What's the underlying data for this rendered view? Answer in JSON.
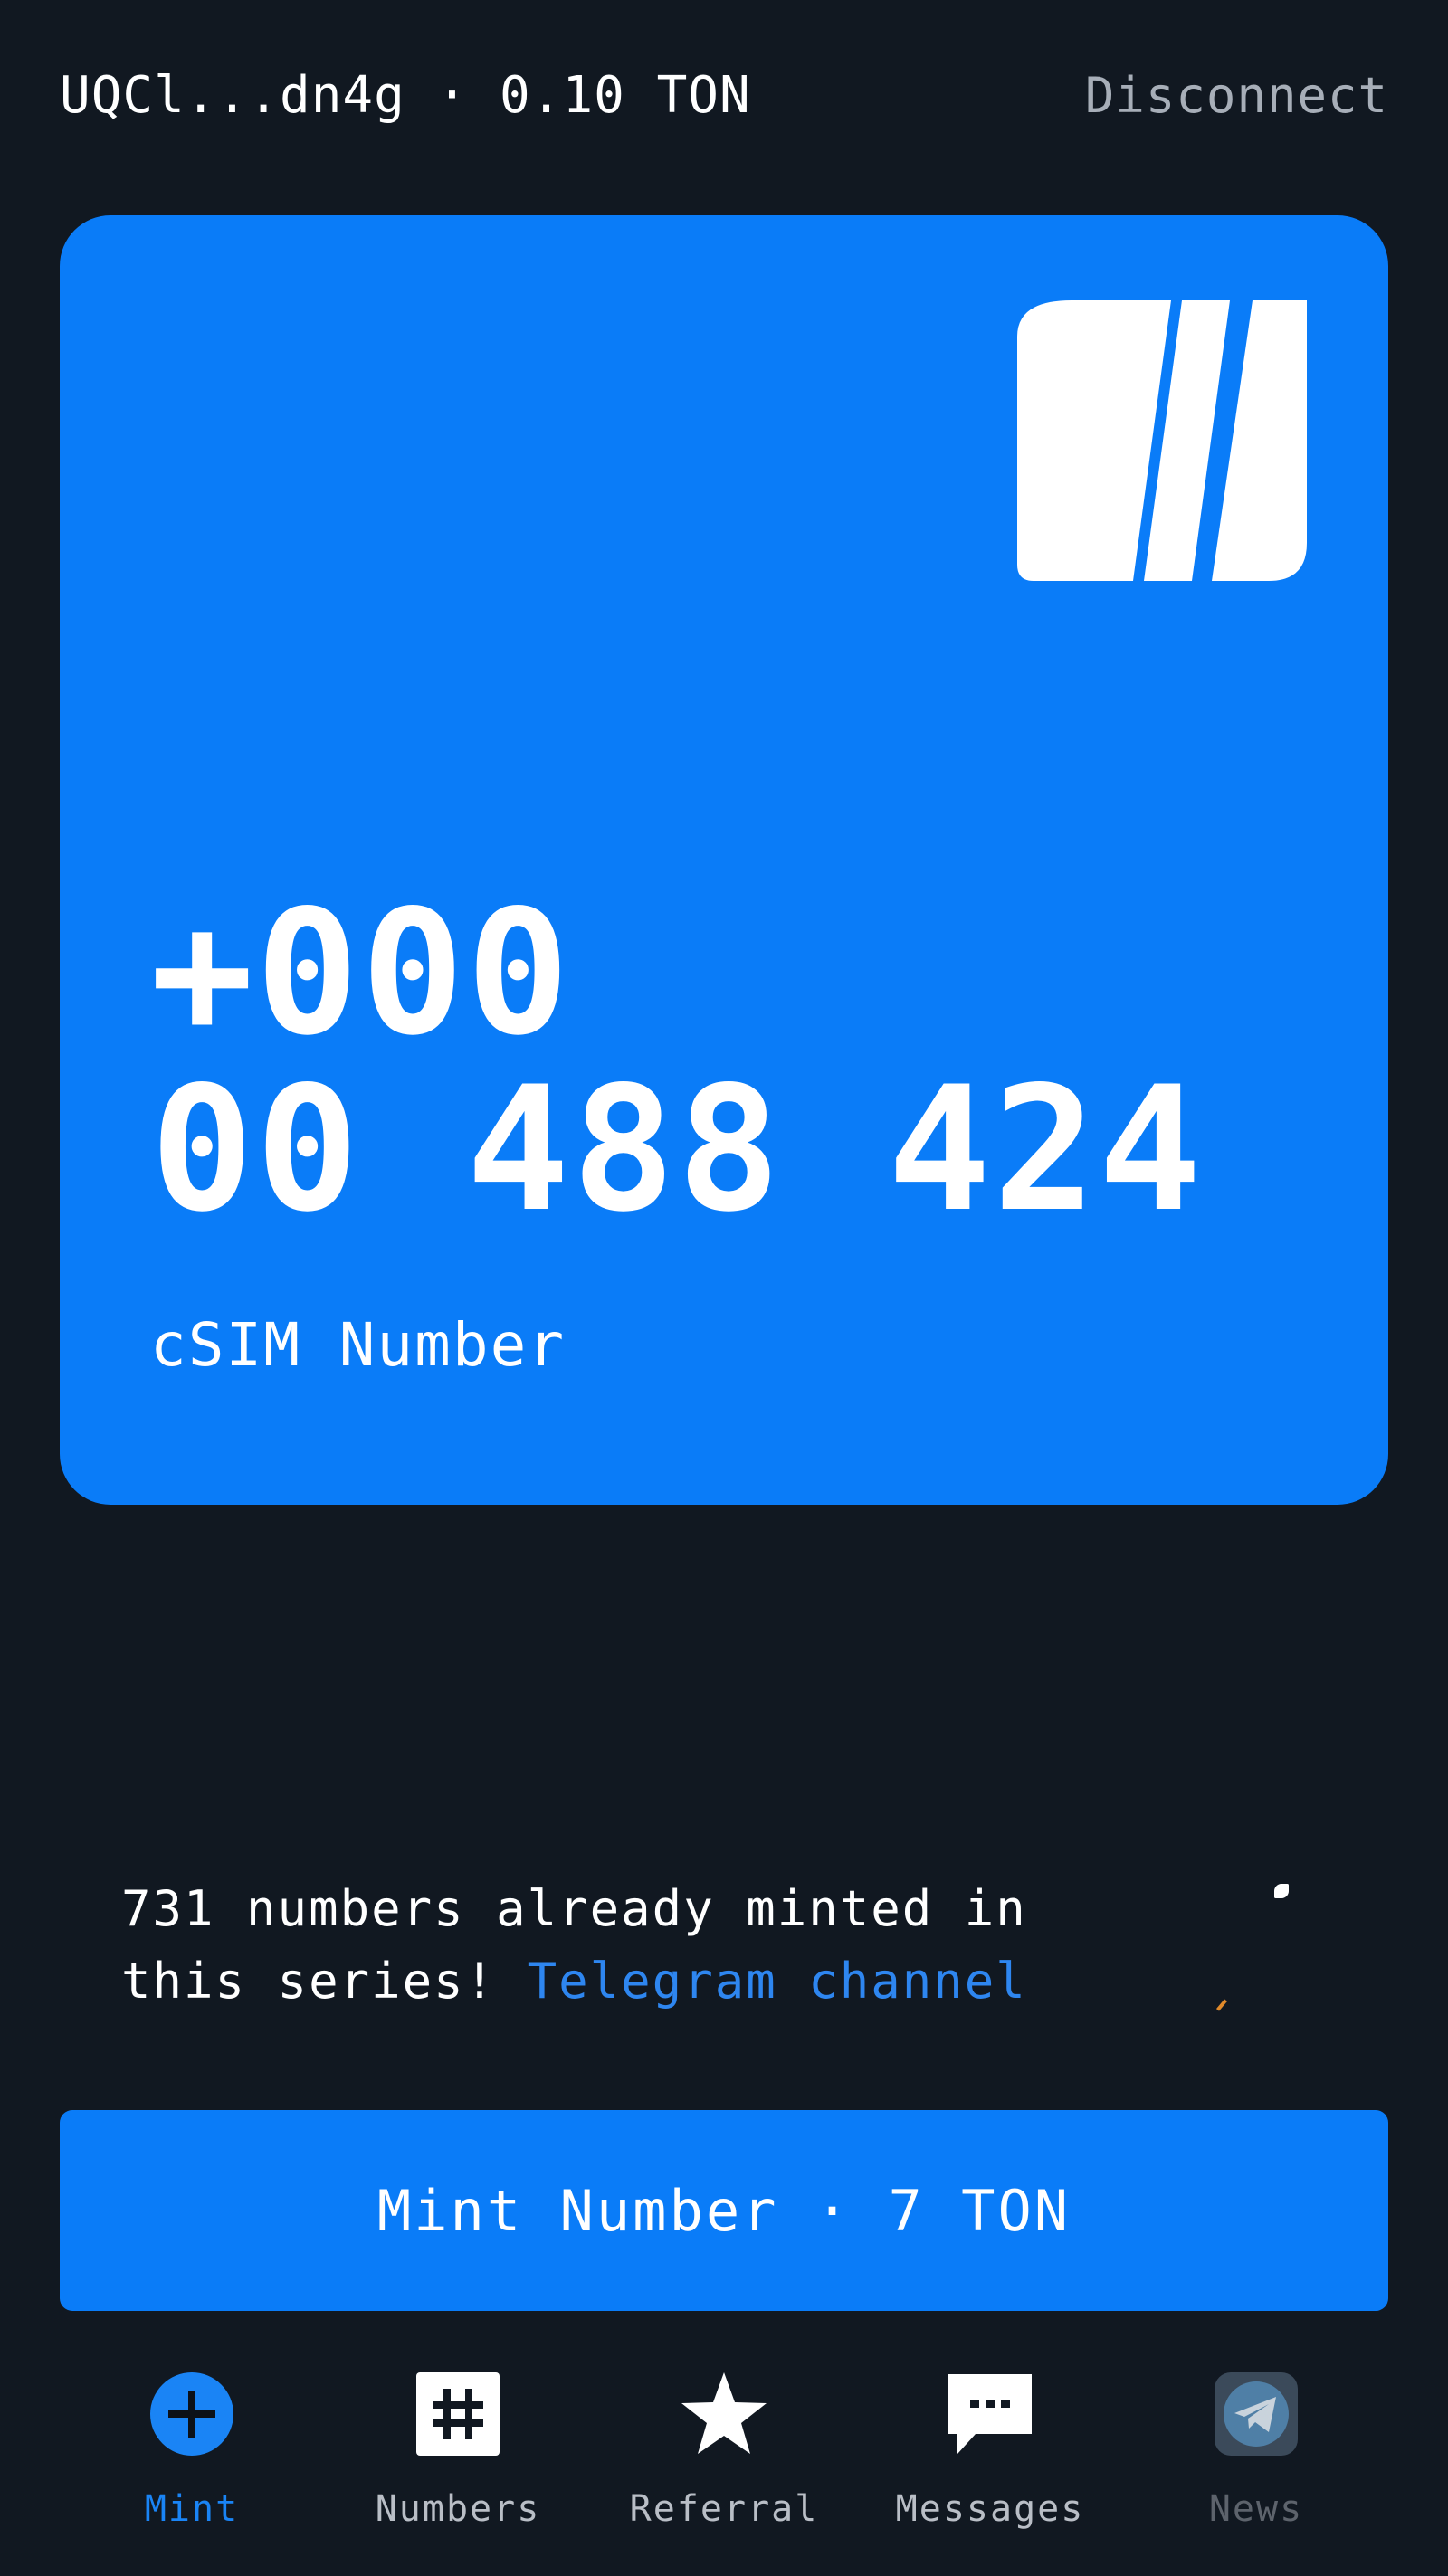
{
  "header": {
    "wallet_text": "UQCl...dn4g · 0.10 TON",
    "disconnect_label": "Disconnect"
  },
  "card": {
    "phone_line1": "+000",
    "phone_line2": "00 488 424",
    "label": "cSIM Number",
    "logo_icon": "fragment-logo-icon"
  },
  "info": {
    "text_prefix": "731 numbers already minted in this series! ",
    "link_label": "Telegram channel"
  },
  "mint_button": {
    "label": "Mint Number · 7 TON"
  },
  "nav": {
    "items": [
      {
        "label": "Mint",
        "icon": "plus-circle-icon",
        "active": true
      },
      {
        "label": "Numbers",
        "icon": "hash-icon"
      },
      {
        "label": "Referral",
        "icon": "star-icon"
      },
      {
        "label": "Messages",
        "icon": "chat-bubble-icon"
      },
      {
        "label": "News",
        "icon": "telegram-icon",
        "dimmed": true
      }
    ]
  },
  "colors": {
    "background": "#111821",
    "accent": "#0a7cf8",
    "link": "#2e86f0",
    "muted_text": "#a7aeb8"
  }
}
